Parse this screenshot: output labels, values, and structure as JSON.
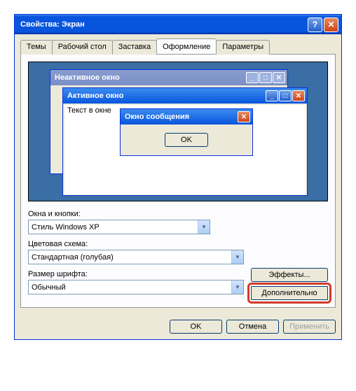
{
  "window": {
    "title": "Свойства: Экран",
    "help": "?",
    "close": "✕"
  },
  "tabs": {
    "items": [
      {
        "label": "Темы"
      },
      {
        "label": "Рабочий стол"
      },
      {
        "label": "Заставка"
      },
      {
        "label": "Оформление"
      },
      {
        "label": "Параметры"
      }
    ]
  },
  "preview": {
    "inactive_title": "Неактивное окно",
    "active_title": "Активное окно",
    "text_in_window": "Текст в окне",
    "msgbox_title": "Окно сообщения",
    "msgbox_ok": "OK",
    "min": "_",
    "max": "□",
    "close": "✕"
  },
  "form": {
    "windows_buttons_label": "Окна и кнопки:",
    "windows_buttons_value": "Стиль Windows XP",
    "color_scheme_label": "Цветовая схема:",
    "color_scheme_value": "Стандартная (голубая)",
    "font_size_label": "Размер шрифта:",
    "font_size_value": "Обычный",
    "effects_btn": "Эффекты...",
    "advanced_btn": "Дополнительно"
  },
  "buttons": {
    "ok": "OK",
    "cancel": "Отмена",
    "apply": "Применить"
  }
}
